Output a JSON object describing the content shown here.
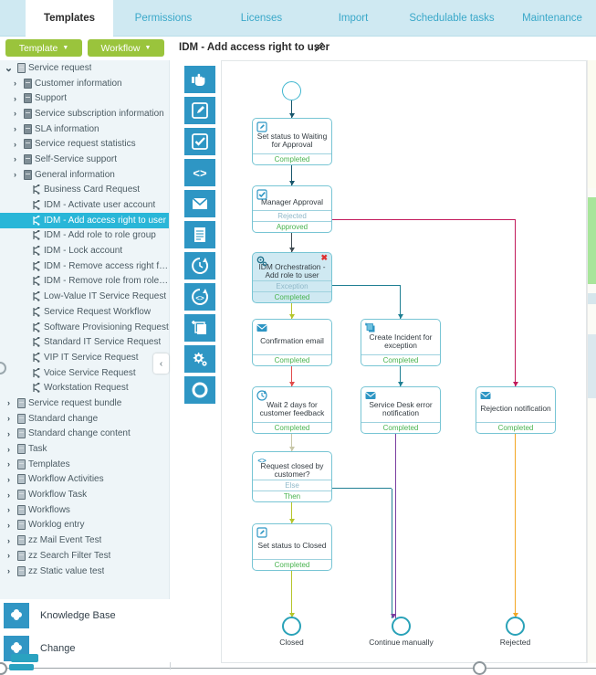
{
  "tabs": [
    {
      "label": "Templates",
      "active": true
    },
    {
      "label": "Permissions",
      "active": false
    },
    {
      "label": "Licenses",
      "active": false
    },
    {
      "label": "Import",
      "active": false
    },
    {
      "label": "Schedulable tasks",
      "active": false
    },
    {
      "label": "Maintenance",
      "active": false
    }
  ],
  "toolbar": {
    "template_button": "Template",
    "workflow_button": "Workflow",
    "caret": "▼"
  },
  "document": {
    "title": "IDM - Add access right to user",
    "edit_icon": "pencil-icon"
  },
  "tree": {
    "items": [
      {
        "label": "Service request",
        "level": 0,
        "twisty": "⌄",
        "icon": "cube-open-icon",
        "selected": false
      },
      {
        "label": "Customer information",
        "level": 1,
        "twisty": "›",
        "icon": "cube-icon",
        "selected": false
      },
      {
        "label": "Support",
        "level": 1,
        "twisty": "›",
        "icon": "cube-icon",
        "selected": false
      },
      {
        "label": "Service subscription information",
        "level": 1,
        "twisty": "›",
        "icon": "cube-icon",
        "selected": false
      },
      {
        "label": "SLA information",
        "level": 1,
        "twisty": "›",
        "icon": "cube-icon",
        "selected": false
      },
      {
        "label": "Service request statistics",
        "level": 1,
        "twisty": "›",
        "icon": "cube-icon",
        "selected": false
      },
      {
        "label": "Self-Service support",
        "level": 1,
        "twisty": "›",
        "icon": "cube-icon",
        "selected": false
      },
      {
        "label": "General information",
        "level": 1,
        "twisty": "›",
        "icon": "cube-icon",
        "selected": false
      },
      {
        "label": "Business Card Request",
        "level": 2,
        "twisty": "",
        "icon": "workflow-icon",
        "selected": false
      },
      {
        "label": "IDM - Activate user account",
        "level": 2,
        "twisty": "",
        "icon": "workflow-icon",
        "selected": false
      },
      {
        "label": "IDM - Add access right to user",
        "level": 2,
        "twisty": "",
        "icon": "workflow-icon",
        "selected": true
      },
      {
        "label": "IDM - Add role to role group",
        "level": 2,
        "twisty": "",
        "icon": "workflow-icon",
        "selected": false
      },
      {
        "label": "IDM - Lock account",
        "level": 2,
        "twisty": "",
        "icon": "workflow-icon",
        "selected": false
      },
      {
        "label": "IDM - Remove access right fro…",
        "level": 2,
        "twisty": "",
        "icon": "workflow-icon",
        "selected": false
      },
      {
        "label": "IDM - Remove role from role gr…",
        "level": 2,
        "twisty": "",
        "icon": "workflow-icon",
        "selected": false
      },
      {
        "label": "Low-Value IT Service Request",
        "level": 2,
        "twisty": "",
        "icon": "workflow-icon",
        "selected": false
      },
      {
        "label": "Service Request Workflow",
        "level": 2,
        "twisty": "",
        "icon": "workflow-icon",
        "selected": false
      },
      {
        "label": "Software Provisioning Request",
        "level": 2,
        "twisty": "",
        "icon": "workflow-icon",
        "selected": false
      },
      {
        "label": "Standard IT Service Request",
        "level": 2,
        "twisty": "",
        "icon": "workflow-icon",
        "selected": false
      },
      {
        "label": "VIP IT Service Request",
        "level": 2,
        "twisty": "",
        "icon": "workflow-icon",
        "selected": false
      },
      {
        "label": "Voice Service Request",
        "level": 2,
        "twisty": "",
        "icon": "workflow-icon",
        "selected": false
      },
      {
        "label": "Workstation Request",
        "level": 2,
        "twisty": "",
        "icon": "workflow-icon",
        "selected": false
      },
      {
        "label": "Service request bundle",
        "level": 0,
        "twisty": "›",
        "icon": "cube-pale-icon",
        "selected": false
      },
      {
        "label": "Standard change",
        "level": 0,
        "twisty": "›",
        "icon": "cube-pale-icon",
        "selected": false
      },
      {
        "label": "Standard change content",
        "level": 0,
        "twisty": "›",
        "icon": "cube-pale-icon",
        "selected": false
      },
      {
        "label": "Task",
        "level": 0,
        "twisty": "›",
        "icon": "cube-pale-icon",
        "selected": false
      },
      {
        "label": "Templates",
        "level": 0,
        "twisty": "›",
        "icon": "cube-pale-icon",
        "selected": false
      },
      {
        "label": "Workflow Activities",
        "level": 0,
        "twisty": "›",
        "icon": "cube-pale-icon",
        "selected": false
      },
      {
        "label": "Workflow Task",
        "level": 0,
        "twisty": "›",
        "icon": "cube-pale-icon",
        "selected": false
      },
      {
        "label": "Workflows",
        "level": 0,
        "twisty": "›",
        "icon": "cube-pale-icon",
        "selected": false
      },
      {
        "label": "Worklog entry",
        "level": 0,
        "twisty": "›",
        "icon": "cube-pale-icon",
        "selected": false
      },
      {
        "label": "zz Mail Event Test",
        "level": 0,
        "twisty": "›",
        "icon": "cube-pale-icon",
        "selected": false
      },
      {
        "label": "zz Search Filter Test",
        "level": 0,
        "twisty": "›",
        "icon": "cube-pale-icon",
        "selected": false
      },
      {
        "label": "zz Static value test",
        "level": 0,
        "twisty": "›",
        "icon": "cube-pale-icon",
        "selected": false
      }
    ],
    "collapse_handle": "‹"
  },
  "modules": [
    {
      "label": "Knowledge Base",
      "icon": "pinwheel-icon"
    },
    {
      "label": "Change",
      "icon": "pinwheel-icon"
    }
  ],
  "palette": {
    "items": [
      {
        "name": "manual-activity-icon"
      },
      {
        "name": "edit-activity-icon"
      },
      {
        "name": "approval-activity-icon"
      },
      {
        "name": "code-activity-icon"
      },
      {
        "name": "email-activity-icon"
      },
      {
        "name": "form-activity-icon"
      },
      {
        "name": "wait-timer-activity-icon"
      },
      {
        "name": "loop-activity-icon"
      },
      {
        "name": "create-object-activity-icon"
      },
      {
        "name": "orchestration-activity-icon"
      },
      {
        "name": "end-node-icon"
      }
    ]
  },
  "workflow": {
    "start": {
      "name": "start-node"
    },
    "nodes": [
      {
        "id": "set-waiting",
        "icon": "edit-activity-icon",
        "title": "Set status to Waiting for Approval",
        "ports": [
          {
            "label": "Completed",
            "type": "completed"
          }
        ],
        "selected": false
      },
      {
        "id": "manager-approval",
        "icon": "approval-activity-icon",
        "title": "Manager Approval",
        "ports": [
          {
            "label": "Rejected",
            "type": "rejected"
          },
          {
            "label": "Approved",
            "type": "approved"
          }
        ],
        "selected": false
      },
      {
        "id": "idm-orchestration",
        "icon": "orchestration-activity-icon",
        "title": "IDM Orchestration - Add role to user",
        "ports": [
          {
            "label": "Exception",
            "type": "exception"
          },
          {
            "label": "Completed",
            "type": "completed"
          }
        ],
        "selected": true,
        "delete_label": "✖"
      },
      {
        "id": "confirmation-email",
        "icon": "email-activity-icon",
        "title": "Confirmation email",
        "ports": [
          {
            "label": "Completed",
            "type": "completed"
          }
        ],
        "selected": false
      },
      {
        "id": "create-incident",
        "icon": "create-object-activity-icon",
        "title": "Create Incident for exception",
        "ports": [
          {
            "label": "Completed",
            "type": "completed"
          }
        ],
        "selected": false
      },
      {
        "id": "sd-error-notification",
        "icon": "email-activity-icon",
        "title": "Service Desk error notification",
        "ports": [
          {
            "label": "Completed",
            "type": "completed"
          }
        ],
        "selected": false
      },
      {
        "id": "rejection-notification",
        "icon": "email-activity-icon",
        "title": "Rejection notification",
        "ports": [
          {
            "label": "Completed",
            "type": "completed"
          }
        ],
        "selected": false
      },
      {
        "id": "wait-2-days",
        "icon": "wait-timer-activity-icon",
        "title": "Wait 2 days for customer feedback",
        "ports": [
          {
            "label": "Completed",
            "type": "completed"
          }
        ],
        "selected": false
      },
      {
        "id": "request-closed",
        "icon": "code-activity-icon",
        "title": "Request closed by customer?",
        "ports": [
          {
            "label": "Else",
            "type": "else"
          },
          {
            "label": "Then",
            "type": "then"
          }
        ],
        "selected": false
      },
      {
        "id": "set-closed",
        "icon": "edit-activity-icon",
        "title": "Set status to Closed",
        "ports": [
          {
            "label": "Completed",
            "type": "completed"
          }
        ],
        "selected": false
      }
    ],
    "terminals": [
      {
        "id": "terminal-closed",
        "label": "Closed"
      },
      {
        "id": "terminal-continue",
        "label": "Continue manually"
      },
      {
        "id": "terminal-rejected",
        "label": "Rejected"
      }
    ]
  },
  "colors": {
    "tab_bar": "#cfe9f2",
    "tab_link": "#3aa8c9",
    "button_green": "#9ac43c",
    "tree_selection": "#29b6d8",
    "tree_background": "#eef5f8",
    "palette_icon": "#2e96c4",
    "node_border": "#77c5d4",
    "node_selected_fill": "#cfe9f2",
    "port_completed": "#48b34e",
    "port_inactive": "#8fb8c9",
    "conn_dark": "#16556b",
    "conn_olive": "#b5c52a",
    "conn_red": "#e14b4b",
    "conn_teal": "#1f7f93",
    "conn_crimson": "#c2195b",
    "conn_purple": "#7b3fa0",
    "conn_orange": "#f3a623",
    "terminal": "#2aa2b8",
    "delete_x": "#e03030"
  }
}
